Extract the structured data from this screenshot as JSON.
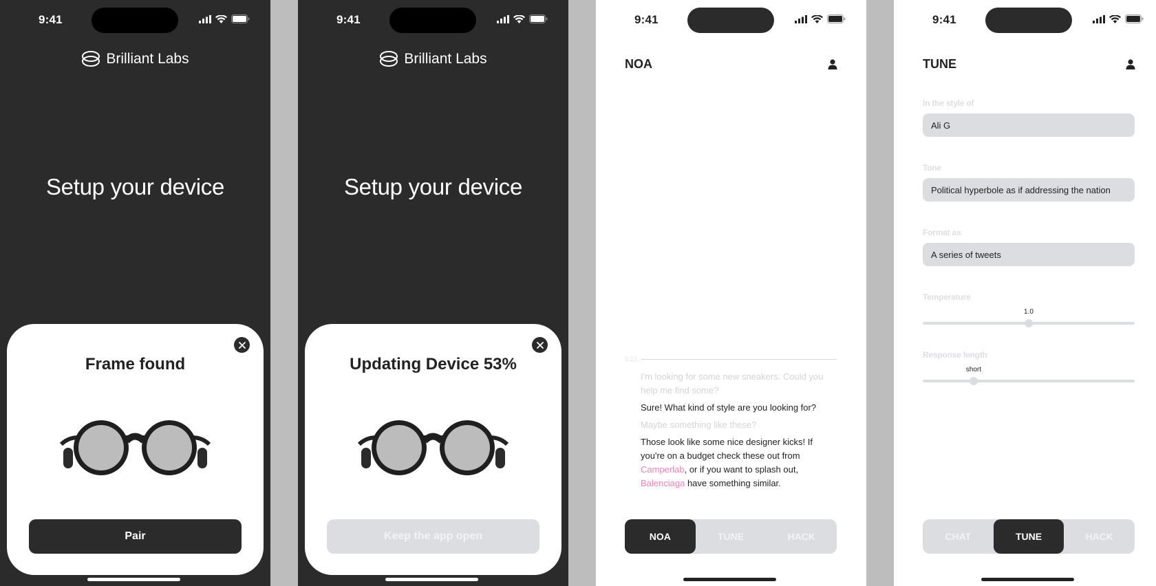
{
  "status_bar": {
    "time": "9:41"
  },
  "screen1": {
    "brand": "Brilliant Labs",
    "heading": "Setup your device",
    "sheet_title": "Frame found",
    "cta": "Pair"
  },
  "screen2": {
    "brand": "Brilliant Labs",
    "heading": "Setup your device",
    "sheet_title": "Updating Device 53%",
    "progress_percent": 53,
    "cta": "Keep the app open"
  },
  "screen3": {
    "title": "NOA",
    "timestamp": "9:23",
    "messages": [
      {
        "role": "user",
        "text": "I'm looking for some new sneakers. Could you help me find some?"
      },
      {
        "role": "ai",
        "text": "Sure! What kind of style are you looking for?"
      },
      {
        "role": "user",
        "text": "Maybe something like these?"
      }
    ],
    "final_message": {
      "part1": "Those look like some nice designer kicks! If you're on a budget check these out from ",
      "link1": "Camperlab",
      "part2": ", or if you want to splash out, ",
      "link2": "Balenciaga",
      "part3": " have something similar."
    },
    "tabs": [
      "NOA",
      "TUNE",
      "HACK"
    ],
    "active_tab": "NOA"
  },
  "screen4": {
    "title": "TUNE",
    "style_label": "In the style of",
    "style_value": "Ali G",
    "tone_label": "Tone",
    "tone_value": "Political hyperbole as if addressing the nation",
    "format_label": "Format as",
    "format_value": "A series of tweets",
    "temperature_label": "Temperature",
    "temperature_value": "1.0",
    "temperature_fraction": 0.5,
    "length_label": "Response length",
    "length_value": "short",
    "length_fraction": 0.24,
    "tabs": [
      "CHAT",
      "TUNE",
      "HACK"
    ],
    "active_tab": "TUNE"
  },
  "colors": {
    "dark_bg": "#2b2b2b",
    "link": "#ef82b6",
    "muted_fill": "#dcdde0"
  }
}
